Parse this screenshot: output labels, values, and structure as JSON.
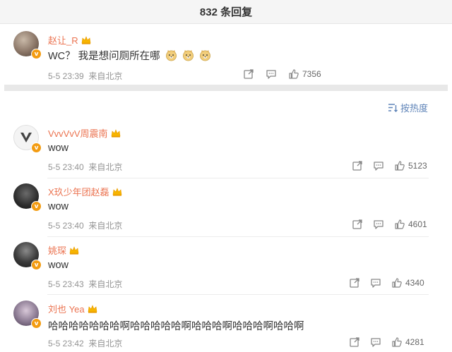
{
  "header": {
    "title": "832 条回复"
  },
  "pinned": {
    "name": "赵让_R",
    "text": "WC？ 我是想问厕所在哪",
    "emojis": [
      "doge",
      "doge",
      "doge"
    ],
    "time": "5-5 23:39",
    "location": "来自北京",
    "likes": "7356"
  },
  "sort": {
    "label": "按热度"
  },
  "comments": [
    {
      "name": "VvvVvV周震南",
      "text": "wow",
      "time": "5-5 23:40",
      "location": "来自北京",
      "likes": "5123"
    },
    {
      "name": "X玖少年团赵磊",
      "text": "wow",
      "time": "5-5 23:40",
      "location": "来自北京",
      "likes": "4601"
    },
    {
      "name": "姚琛",
      "text": "wow",
      "time": "5-5 23:43",
      "location": "来自北京",
      "likes": "4340"
    },
    {
      "name": "刘也 Yea",
      "text": "哈哈哈哈哈哈哈啊哈哈哈哈哈啊哈哈哈啊哈哈哈啊哈哈啊",
      "time": "5-5 23:42",
      "location": "来自北京",
      "likes": "4281"
    }
  ],
  "colors": {
    "username": "#eb7350",
    "link": "#5f84b8",
    "badge": "#f39c12",
    "meta": "#939393"
  },
  "icons": [
    "share-icon",
    "comment-icon",
    "thumbs-up-icon",
    "sort-icon",
    "verified-badge-icon",
    "crown-badge-icon",
    "doge-emoji-icon"
  ]
}
